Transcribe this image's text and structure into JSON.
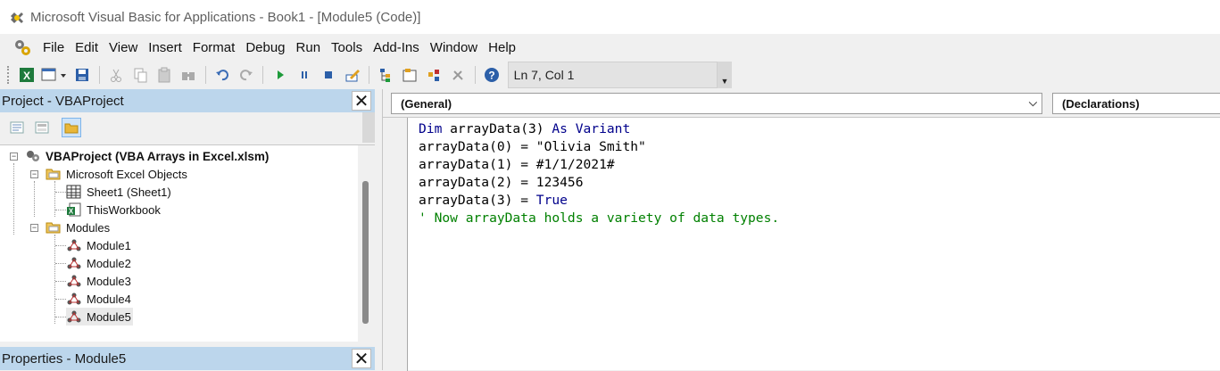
{
  "window": {
    "title": "Microsoft Visual Basic for Applications - Book1 - [Module5 (Code)]"
  },
  "menubar": {
    "items": [
      "File",
      "Edit",
      "View",
      "Insert",
      "Format",
      "Debug",
      "Run",
      "Tools",
      "Add-Ins",
      "Window",
      "Help"
    ]
  },
  "toolbar": {
    "position_readout": "Ln 7, Col 1",
    "icons": [
      "excel-icon",
      "insert-module-icon",
      "save-icon",
      "cut-icon",
      "copy-icon",
      "paste-icon",
      "find-icon",
      "undo-icon",
      "redo-icon",
      "run-icon",
      "break-icon",
      "reset-icon",
      "design-mode-icon",
      "project-explorer-icon",
      "properties-icon",
      "object-browser-icon",
      "toolbox-icon",
      "help-icon"
    ]
  },
  "project_pane": {
    "title": "Project - VBAProject",
    "tree": {
      "root": "VBAProject (VBA Arrays in Excel.xlsm)",
      "excel_objects_folder": "Microsoft Excel Objects",
      "sheet1": "Sheet1 (Sheet1)",
      "thisworkbook": "ThisWorkbook",
      "modules_folder": "Modules",
      "modules": [
        "Module1",
        "Module2",
        "Module3",
        "Module4",
        "Module5"
      ]
    }
  },
  "properties_pane": {
    "title": "Properties - Module5"
  },
  "code_window": {
    "object_combo": "(General)",
    "procedure_combo": "(Declarations)",
    "lines": {
      "l1_kw1": "Dim",
      "l1_mid": " arrayData(3) ",
      "l1_kw2": "As Variant",
      "l2": "arrayData(0) = \"Olivia Smith\"",
      "l3": "arrayData(1) = #1/1/2021#",
      "l4": "arrayData(2) = 123456",
      "l5_pre": "arrayData(3) = ",
      "l5_kw": "True",
      "l6": "' Now arrayData holds a variety of data types."
    }
  },
  "colors": {
    "pane_header": "#bcd6ec",
    "keyword": "#00008b",
    "comment": "#008000"
  }
}
